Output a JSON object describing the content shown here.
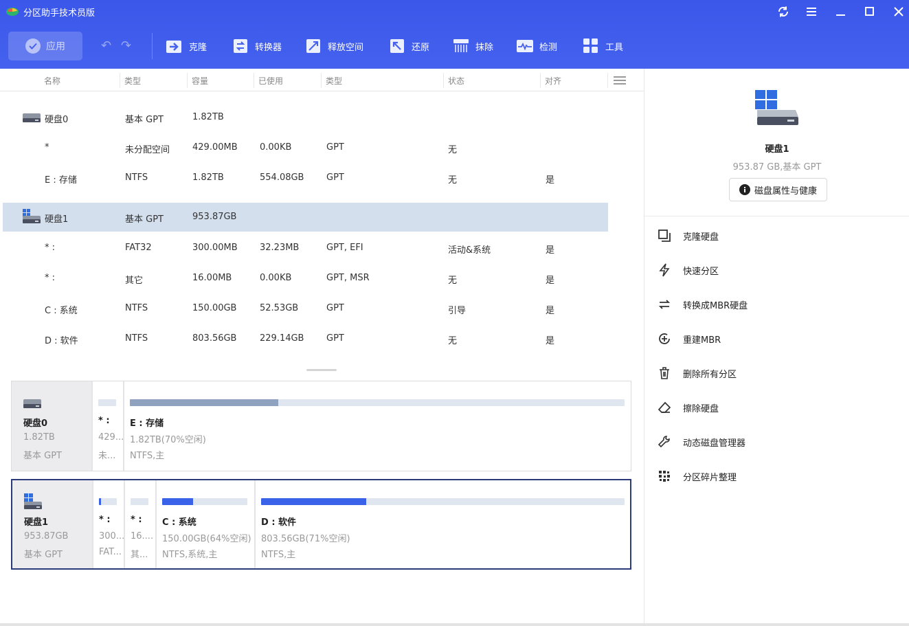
{
  "app": {
    "title": "分区助手技术员版"
  },
  "colors": {
    "header": "#3b57ea",
    "accent_fill": "#3a62e8",
    "used_fill_disk0": "#8fa3c0",
    "selected_row": "#d4dfee",
    "selected_border": "#2a3a7a"
  },
  "toolbar": {
    "apply_label": "应用",
    "tools": [
      {
        "label": "克隆",
        "icon": "clone-icon"
      },
      {
        "label": "转换器",
        "icon": "converter-icon"
      },
      {
        "label": "释放空间",
        "icon": "free-space-icon"
      },
      {
        "label": "还原",
        "icon": "restore-icon"
      },
      {
        "label": "抹除",
        "icon": "wipe-icon"
      },
      {
        "label": "检测",
        "icon": "detect-icon"
      },
      {
        "label": "工具",
        "icon": "tools-icon"
      }
    ]
  },
  "table": {
    "headers": [
      "名称",
      "类型",
      "容量",
      "已使用",
      "类型",
      "状态",
      "对齐"
    ],
    "rows": [
      {
        "name": "硬盘0",
        "type": "基本 GPT",
        "capacity": "1.82TB",
        "used": "",
        "ftype": "",
        "status": "",
        "align": ""
      },
      {
        "name": "*",
        "type": "未分配空间",
        "capacity": "429.00MB",
        "used": "0.00KB",
        "ftype": "GPT",
        "status": "无",
        "align": ""
      },
      {
        "name": "E : 存储",
        "type": "NTFS",
        "capacity": "1.82TB",
        "used": "554.08GB",
        "ftype": "GPT",
        "status": "无",
        "align": "是"
      },
      {
        "name": "硬盘1",
        "type": "基本 GPT",
        "capacity": "953.87GB",
        "used": "",
        "ftype": "",
        "status": "",
        "align": ""
      },
      {
        "name": "* :",
        "type": "FAT32",
        "capacity": "300.00MB",
        "used": "32.23MB",
        "ftype": "GPT, EFI",
        "status": "活动&系统",
        "align": "是"
      },
      {
        "name": "* :",
        "type": "其它",
        "capacity": "16.00MB",
        "used": "0.00KB",
        "ftype": "GPT, MSR",
        "status": "无",
        "align": "是"
      },
      {
        "name": "C : 系统",
        "type": "NTFS",
        "capacity": "150.00GB",
        "used": "52.53GB",
        "ftype": "GPT",
        "status": "引导",
        "align": "是"
      },
      {
        "name": "D : 软件",
        "type": "NTFS",
        "capacity": "803.56GB",
        "used": "229.14GB",
        "ftype": "GPT",
        "status": "无",
        "align": "是"
      }
    ]
  },
  "disk0": {
    "name": "硬盘0",
    "size": "1.82TB",
    "type": "基本 GPT",
    "parts": [
      {
        "label": "* :",
        "size": "429...",
        "fs": "未...",
        "used_fraction": 0.0
      },
      {
        "label": "E : 存储",
        "size": "1.82TB(70%空闲)",
        "fs": "NTFS,主",
        "used_fraction": 0.3
      }
    ]
  },
  "disk1": {
    "name": "硬盘1",
    "size": "953.87GB",
    "type": "基本 GPT",
    "parts": [
      {
        "label": "* :",
        "size": "300...",
        "fs": "FAT...",
        "used_fraction": 0.11
      },
      {
        "label": "* :",
        "size": "16....",
        "fs": "其...",
        "used_fraction": 0.0
      },
      {
        "label": "C : 系统",
        "size": "150.00GB(64%空闲)",
        "fs": "NTFS,系统,主",
        "used_fraction": 0.36
      },
      {
        "label": "D : 软件",
        "size": "803.56GB(71%空闲)",
        "fs": "NTFS,主",
        "used_fraction": 0.29
      }
    ]
  },
  "rpanel": {
    "disk_name": "硬盘1",
    "disk_sub": "953.87 GB,基本 GPT",
    "props_btn": "磁盘属性与健康",
    "actions": [
      {
        "label": "克隆硬盘",
        "icon": "clone-disk-icon"
      },
      {
        "label": "快速分区",
        "icon": "lightning-icon"
      },
      {
        "label": "转换成MBR硬盘",
        "icon": "convert-arrows-icon"
      },
      {
        "label": "重建MBR",
        "icon": "rebuild-icon"
      },
      {
        "label": "删除所有分区",
        "icon": "trash-icon"
      },
      {
        "label": "擦除硬盘",
        "icon": "eraser-icon"
      },
      {
        "label": "动态磁盘管理器",
        "icon": "wrench-icon"
      },
      {
        "label": "分区碎片整理",
        "icon": "defrag-icon"
      }
    ]
  }
}
